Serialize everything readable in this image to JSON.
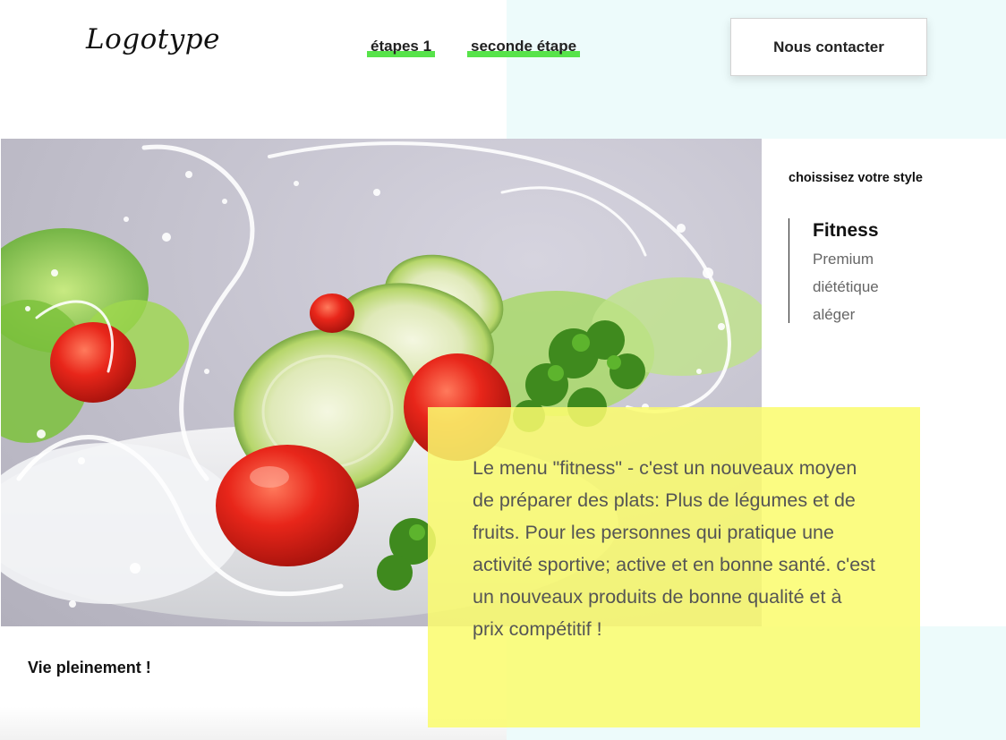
{
  "header": {
    "logo": "Logotype",
    "nav": [
      {
        "label": "étapes 1"
      },
      {
        "label": "seconde étape"
      }
    ],
    "contact_label": "Nous contacter",
    "accent_color": "#57e34a"
  },
  "hero": {
    "image_alt": "salade de légumes éclaboussée d'eau"
  },
  "style_panel": {
    "title": "choissisez votre style",
    "items": [
      {
        "label": "Fitness",
        "active": true
      },
      {
        "label": "Premium"
      },
      {
        "label": "diététique"
      },
      {
        "label": "aléger"
      }
    ]
  },
  "tagline": "Vie pleinement !",
  "description": {
    "text": "Le menu \"fitness\" - c'est un nouveaux moyen de préparer des plats: Plus de légumes et de fruits. Pour les personnes qui pratique une activité sportive; active et en bonne santé. c'est un nouveaux produits de bonne qualité et à prix compétitif !",
    "background": "#f9fb6e"
  }
}
